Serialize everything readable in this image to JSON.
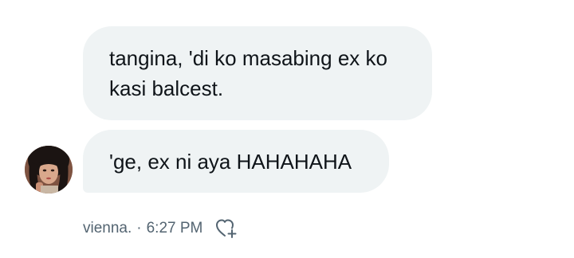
{
  "conversation": {
    "messages": [
      {
        "sender": "other",
        "text": "tangina, 'di ko masabing ex ko kasi balcest."
      },
      {
        "sender": "other",
        "text": "'ge, ex ni aya HAHAHAHA"
      }
    ],
    "meta": {
      "author": "vienna.",
      "separator": "·",
      "time": "6:27 PM"
    },
    "icons": {
      "avatar": "avatar",
      "reaction": "add-reaction-heart-icon"
    }
  }
}
